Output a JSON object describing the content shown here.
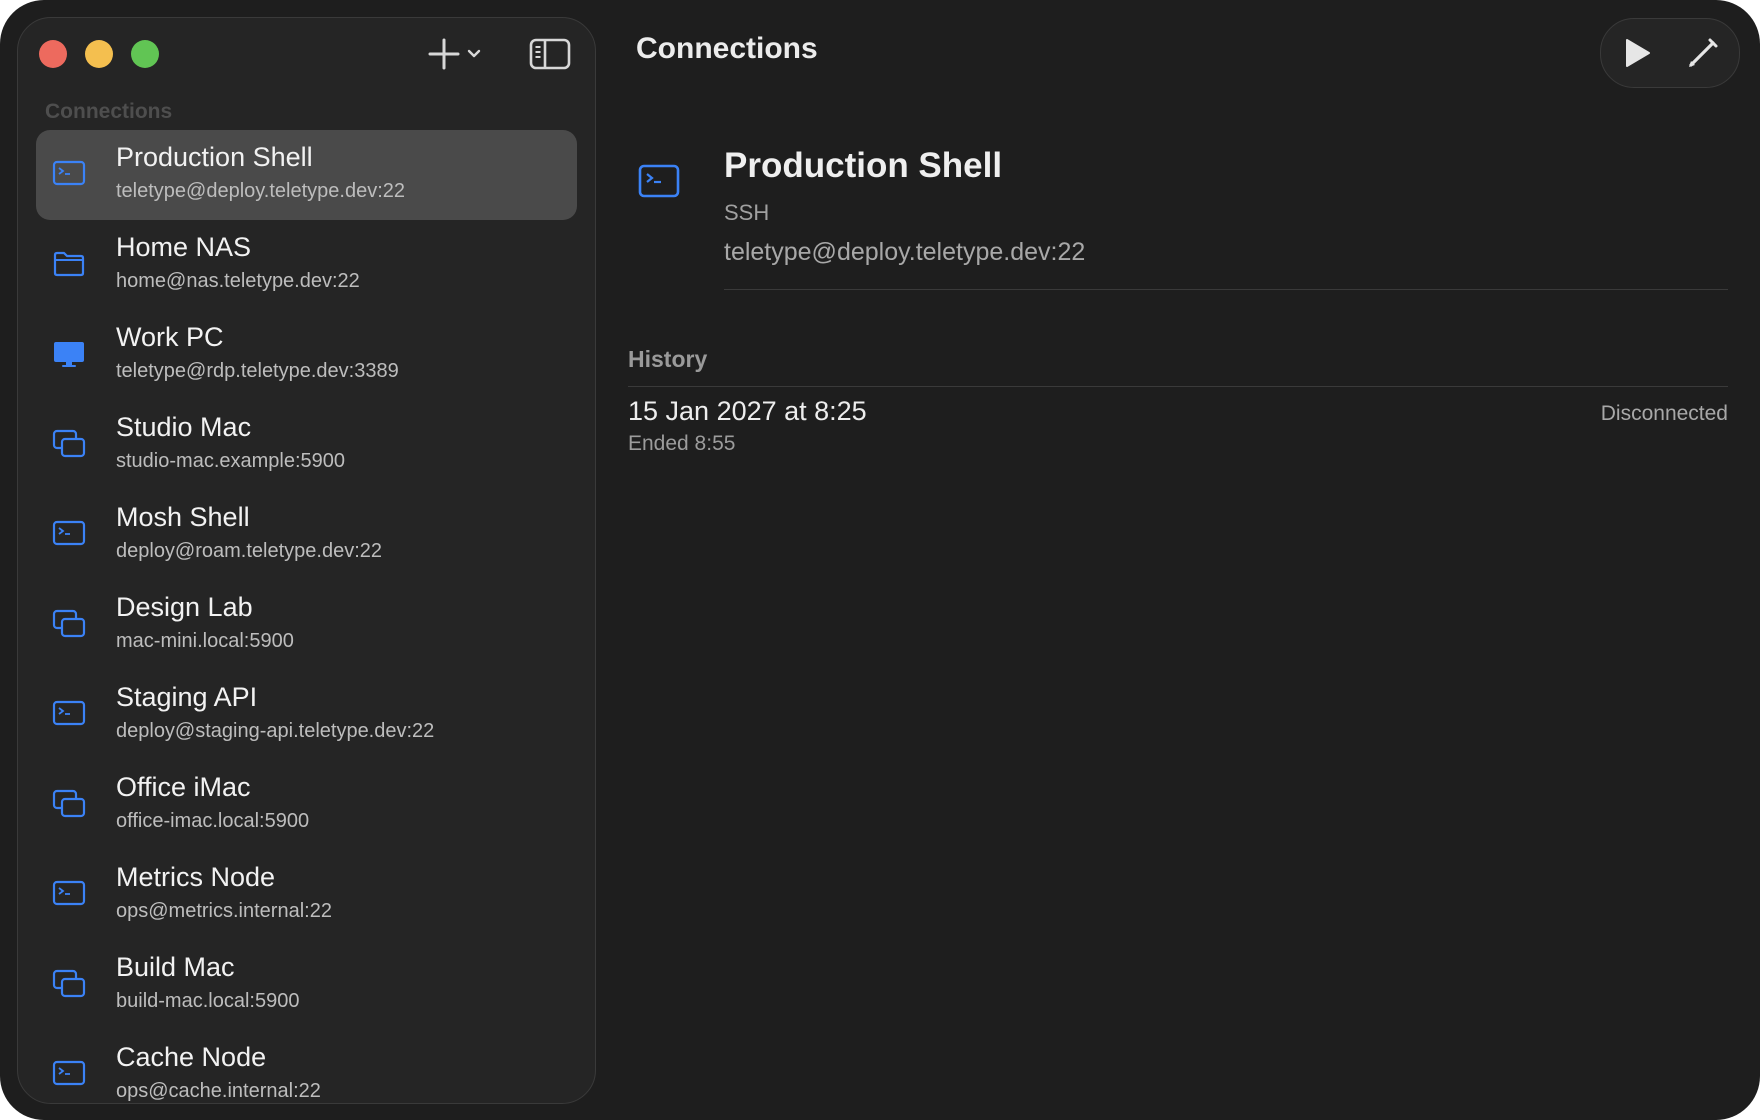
{
  "sidebar": {
    "section_label": "Connections",
    "items": [
      {
        "title": "Production Shell",
        "subtitle": "teletype@deploy.teletype.dev:22",
        "icon": "terminal-icon",
        "selected": true
      },
      {
        "title": "Home NAS",
        "subtitle": "home@nas.teletype.dev:22",
        "icon": "folder-icon",
        "selected": false
      },
      {
        "title": "Work PC",
        "subtitle": "teletype@rdp.teletype.dev:3389",
        "icon": "monitor-icon",
        "selected": false
      },
      {
        "title": "Studio Mac",
        "subtitle": "studio-mac.example:5900",
        "icon": "screens-icon",
        "selected": false
      },
      {
        "title": "Mosh Shell",
        "subtitle": "deploy@roam.teletype.dev:22",
        "icon": "terminal-icon",
        "selected": false
      },
      {
        "title": "Design Lab",
        "subtitle": "mac-mini.local:5900",
        "icon": "screens-icon",
        "selected": false
      },
      {
        "title": "Staging API",
        "subtitle": "deploy@staging-api.teletype.dev:22",
        "icon": "terminal-icon",
        "selected": false
      },
      {
        "title": "Office iMac",
        "subtitle": "office-imac.local:5900",
        "icon": "screens-icon",
        "selected": false
      },
      {
        "title": "Metrics Node",
        "subtitle": "ops@metrics.internal:22",
        "icon": "terminal-icon",
        "selected": false
      },
      {
        "title": "Build Mac",
        "subtitle": "build-mac.local:5900",
        "icon": "screens-icon",
        "selected": false
      },
      {
        "title": "Cache Node",
        "subtitle": "ops@cache.internal:22",
        "icon": "terminal-icon",
        "selected": false
      }
    ]
  },
  "main": {
    "title": "Connections",
    "detail": {
      "name": "Production Shell",
      "type": "SSH",
      "address": "teletype@deploy.teletype.dev:22"
    },
    "history": {
      "label": "History",
      "entries": [
        {
          "date": "15 Jan 2027 at 8:25",
          "ended": "Ended 8:55",
          "status": "Disconnected"
        }
      ]
    }
  },
  "colors": {
    "accent": "#3b82f6",
    "window_bg": "#1e1e1e",
    "sidebar_bg": "#252525",
    "selected_bg": "#4a4a4a"
  }
}
